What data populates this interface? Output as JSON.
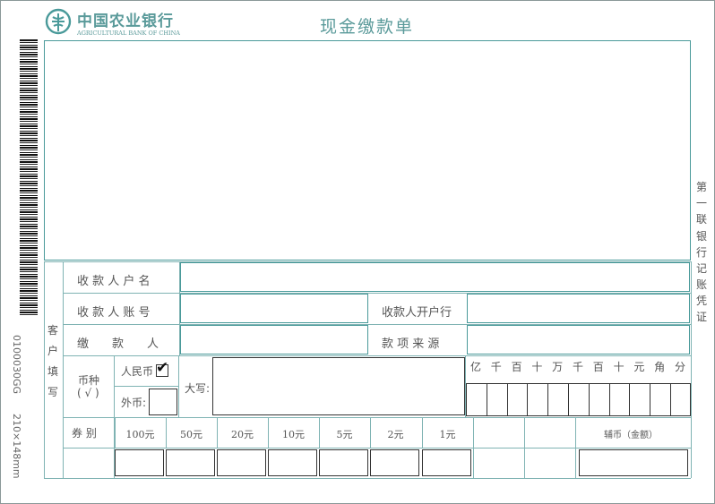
{
  "bank": {
    "name_cn": "中国农业银行",
    "name_en": "AGRICULTURAL BANK OF CHINA"
  },
  "form_title": "现金缴款单",
  "copy_label": "第一联",
  "copy_purpose": "银行记账凭证",
  "side_code": "0100030GG",
  "side_size": "210×148mm",
  "filler_label": "客户填写",
  "fields": {
    "payee_name": "收 款 人 户 名",
    "payee_account": "收 款 人 账 号",
    "payee_bank": "收款人开户行",
    "payer": "缴　　款　　人",
    "source": "款 项 来 源"
  },
  "currency": {
    "label": "币种",
    "check_hint": "( √ )",
    "rmb": "人民币",
    "rmb_checked": "✔",
    "foreign": "外币:",
    "capital": "大写:"
  },
  "amount_units": [
    "亿",
    "千",
    "百",
    "十",
    "万",
    "千",
    "百",
    "十",
    "元",
    "角",
    "分"
  ],
  "denominations": {
    "label": "券 别",
    "items": [
      "100元",
      "50元",
      "20元",
      "10元",
      "5元",
      "2元",
      "1元"
    ],
    "coin_label": "辅币（金额）"
  }
}
